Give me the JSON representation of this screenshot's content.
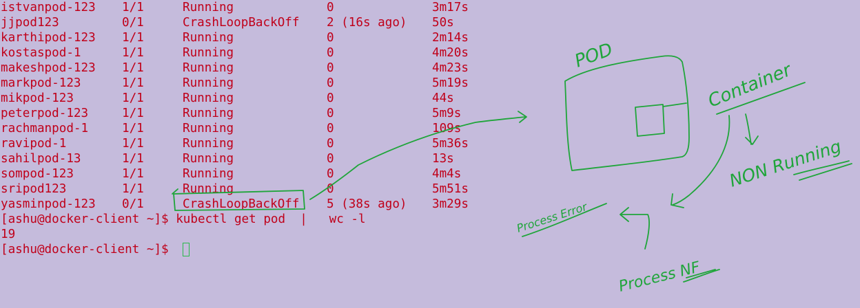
{
  "terminal": {
    "pods": [
      {
        "name": "istvanpod-123",
        "ready": "1/1",
        "status": "Running",
        "restarts": "0",
        "age": "3m17s"
      },
      {
        "name": "jjpod123",
        "ready": "0/1",
        "status": "CrashLoopBackOff",
        "restarts": "2 (16s ago)",
        "age": "50s"
      },
      {
        "name": "karthipod-123",
        "ready": "1/1",
        "status": "Running",
        "restarts": "0",
        "age": "2m14s"
      },
      {
        "name": "kostaspod-1",
        "ready": "1/1",
        "status": "Running",
        "restarts": "0",
        "age": "4m20s"
      },
      {
        "name": "makeshpod-123",
        "ready": "1/1",
        "status": "Running",
        "restarts": "0",
        "age": "4m23s"
      },
      {
        "name": "markpod-123",
        "ready": "1/1",
        "status": "Running",
        "restarts": "0",
        "age": "5m19s"
      },
      {
        "name": "mikpod-123",
        "ready": "1/1",
        "status": "Running",
        "restarts": "0",
        "age": "44s"
      },
      {
        "name": "peterpod-123",
        "ready": "1/1",
        "status": "Running",
        "restarts": "0",
        "age": "5m9s"
      },
      {
        "name": "rachmanpod-1",
        "ready": "1/1",
        "status": "Running",
        "restarts": "0",
        "age": "109s"
      },
      {
        "name": "ravipod-1",
        "ready": "1/1",
        "status": "Running",
        "restarts": "0",
        "age": "5m36s"
      },
      {
        "name": "sahilpod-13",
        "ready": "1/1",
        "status": "Running",
        "restarts": "0",
        "age": "13s"
      },
      {
        "name": "sompod-123",
        "ready": "1/1",
        "status": "Running",
        "restarts": "0",
        "age": "4m4s"
      },
      {
        "name": "sripod123",
        "ready": "1/1",
        "status": "Running",
        "restarts": "0",
        "age": "5m51s"
      },
      {
        "name": "yasminpod-123",
        "ready": "0/1",
        "status": "CrashLoopBackOff",
        "restarts": "5 (38s ago)",
        "age": "3m29s"
      }
    ],
    "command_line": "[ashu@docker-client ~]$ kubectl get pod  |   wc -l",
    "command_output": "19",
    "prompt": "[ashu@docker-client ~]$ "
  },
  "annotations": {
    "pod_label": "POD",
    "container_label": "Container",
    "non_running_label": "NON Running",
    "process_error_label": "Process Error",
    "process_nf_label": "Process NF"
  },
  "colors": {
    "background": "#c5bbdc",
    "terminal_text": "#c0001a",
    "ink": "#1fa53a"
  }
}
